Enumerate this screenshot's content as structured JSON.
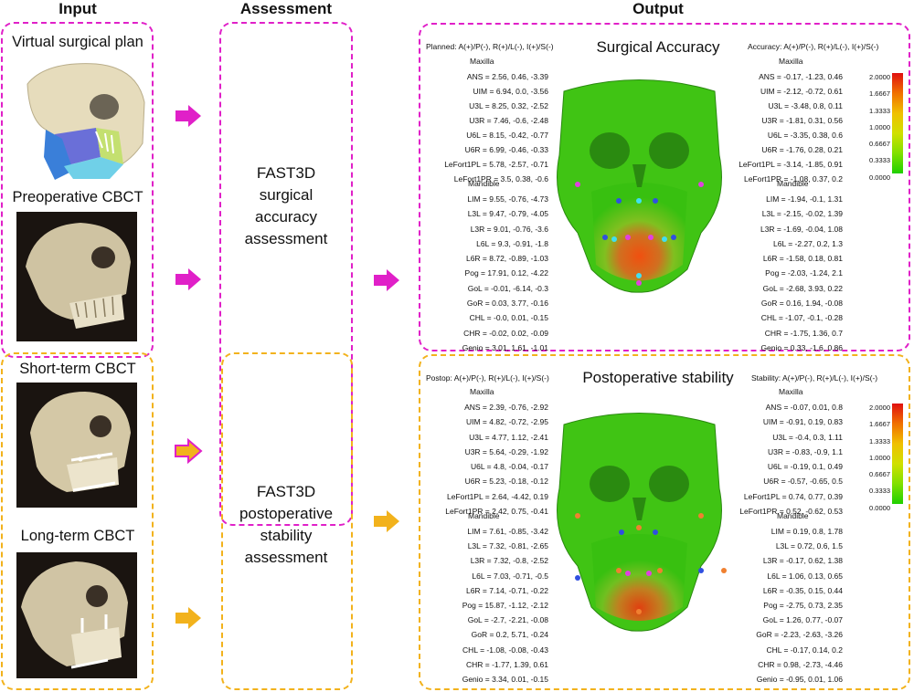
{
  "columns": {
    "input": "Input",
    "assessment": "Assessment",
    "output": "Output"
  },
  "inputs": [
    {
      "label": "Virtual surgical plan"
    },
    {
      "label": "Preoperative CBCT"
    },
    {
      "label": "Short-term CBCT"
    },
    {
      "label": "Long-term CBCT"
    }
  ],
  "assessments": [
    {
      "lines": [
        "FAST3D",
        "surgical",
        "accuracy",
        "assessment"
      ]
    },
    {
      "lines": [
        "FAST3D",
        "postoperative",
        "stability",
        "assessment"
      ]
    }
  ],
  "colors": {
    "magenta": "#e020c8",
    "yellow": "#f2b21c"
  },
  "panels": [
    {
      "title": "Surgical Accuracy",
      "left_header": "Planned: A(+)/P(-), R(+)/L(-), I(+)/S(-)",
      "right_header": "Accuracy: A(+)/P(-), R(+)/L(-), I(+)/S(-)",
      "maxilla": "Maxilla",
      "mandible": "Mandible",
      "left_maxilla": [
        "ANS = 2.56, 0.46, -3.39",
        "UIM = 6.94, 0.0, -3.56",
        "U3L = 8.25, 0.32, -2.52",
        "U3R = 7.46, -0.6, -2.48",
        "U6L = 8.15, -0.42, -0.77",
        "U6R = 6.99, -0.46, -0.33",
        "LeFort1PL = 5.78, -2.57, -0.71",
        "LeFort1PR = 3.5, 0.38, -0.6"
      ],
      "left_mandible": [
        "LIM = 9.55, -0.76, -4.73",
        "L3L = 9.47, -0.79, -4.05",
        "L3R = 9.01, -0.76, -3.6",
        "L6L = 9.3, -0.91, -1.8",
        "L6R = 8.72, -0.89, -1.03",
        "Pog = 17.91, 0.12, -4.22",
        "GoL = -0.01, -6.14, -0.3",
        "GoR = 0.03, 3.77, -0.16",
        "CHL = -0.0, 0.01, -0.15",
        "CHR = -0.02, 0.02, -0.09",
        "Genio = 3.01, 1.61, -1.01"
      ],
      "right_maxilla": [
        "ANS = -0.17, -1.23, 0.46",
        "UIM = -2.12, -0.72, 0.61",
        "U3L = -3.48, 0.8, 0.11",
        "U3R = -1.81, 0.31, 0.56",
        "U6L = -3.35, 0.38, 0.6",
        "U6R = -1.76, 0.28, 0.21",
        "LeFort1PL = -3.14, -1.85, 0.91",
        "LeFort1PR = -1.08, 0.37, 0.2"
      ],
      "right_mandible": [
        "LIM = -1.94, -0.1, 1.31",
        "L3L = -2.15, -0.02, 1.39",
        "L3R = -1.69, -0.04, 1.08",
        "L6L = -2.27, 0.2, 1.3",
        "L6R = -1.58, 0.18, 0.81",
        "Pog = -2.03, -1.24, 2.1",
        "GoL = -2.68, 3.93, 0.22",
        "GoR = 0.16, 1.94, -0.08",
        "CHL = -1.07, -0.1, -0.28",
        "CHR = -1.75, 1.36, 0.7",
        "Genio = 0.33, -1.6, 0.86"
      ],
      "scale": [
        "2.0000",
        "1.6667",
        "1.3333",
        "1.0000",
        "0.6667",
        "0.3333",
        "0.0000"
      ]
    },
    {
      "title": "Postoperative stability",
      "left_header": "Postop: A(+)/P(-), R(+)/L(-), I(+)/S(-)",
      "right_header": "Stability: A(+)/P(-), R(+)/L(-), I(+)/S(-)",
      "maxilla": "Maxilla",
      "mandible": "Mandible",
      "left_maxilla": [
        "ANS = 2.39, -0.76, -2.92",
        "UIM = 4.82, -0.72, -2.95",
        "U3L = 4.77, 1.12, -2.41",
        "U3R = 5.64, -0.29, -1.92",
        "U6L = 4.8, -0.04, -0.17",
        "U6R = 5.23, -0.18, -0.12",
        "LeFort1PL = 2.64, -4.42, 0.19",
        "LeFort1PR = 2.42, 0.75, -0.41"
      ],
      "left_mandible": [
        "LIM = 7.61, -0.85, -3.42",
        "L3L = 7.32, -0.81, -2.65",
        "L3R = 7.32, -0.8, -2.52",
        "L6L = 7.03, -0.71, -0.5",
        "L6R = 7.14, -0.71, -0.22",
        "Pog = 15.87, -1.12, -2.12",
        "GoL = -2.7, -2.21, -0.08",
        "GoR = 0.2, 5.71, -0.24",
        "CHL = -1.08, -0.08, -0.43",
        "CHR = -1.77, 1.39, 0.61",
        "Genio = 3.34, 0.01, -0.15"
      ],
      "right_maxilla": [
        "ANS = -0.07, 0.01, 0.8",
        "UIM = -0.91, 0.19, 0.83",
        "U3L = -0.4, 0.3, 1.11",
        "U3R = -0.83, -0.9, 1.1",
        "U6L = -0.19, 0.1, 0.49",
        "U6R = -0.57, -0.65, 0.5",
        "LeFort1PL = 0.74, 0.77, 0.39",
        "LeFort1PR = 0.52, -0.62, 0.53"
      ],
      "right_mandible": [
        "LIM = 0.19, 0.8, 1.78",
        "L3L = 0.72, 0.6, 1.5",
        "L3R = -0.17, 0.62, 1.38",
        "L6L = 1.06, 0.13, 0.65",
        "L6R = -0.35, 0.15, 0.44",
        "Pog = -2.75, 0.73, 2.35",
        "GoL = 1.26, 0.77, -0.07",
        "GoR = -2.23, -2.63, -3.26",
        "CHL = -0.17, 0.14, 0.2",
        "CHR = 0.98, -2.73, -4.46",
        "Genio = -0.95, 0.01, 1.06"
      ],
      "scale": [
        "2.0000",
        "1.6667",
        "1.3333",
        "1.0000",
        "0.6667",
        "0.3333",
        "0.0000"
      ]
    }
  ]
}
